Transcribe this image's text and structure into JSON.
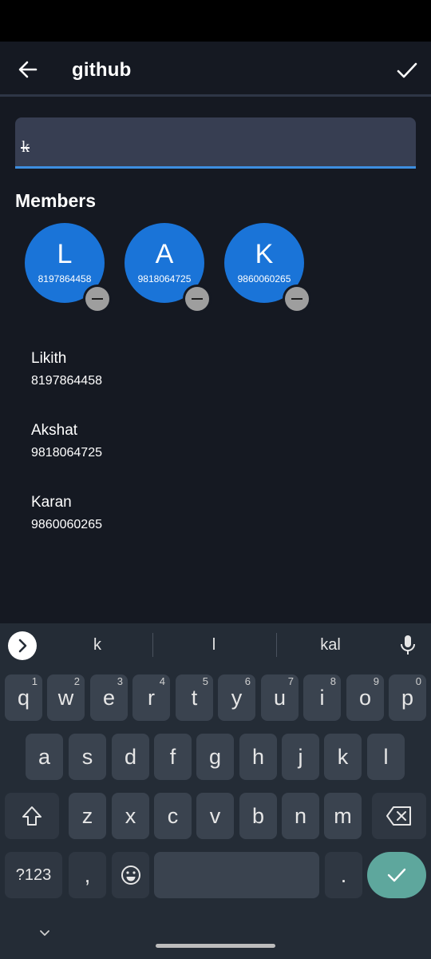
{
  "app_bar": {
    "title": "github"
  },
  "search": {
    "value": "k",
    "placeholder": ""
  },
  "members": {
    "title": "Members",
    "chips": [
      {
        "letter": "L",
        "phone": "8197864458"
      },
      {
        "letter": "A",
        "phone": "9818064725"
      },
      {
        "letter": "K",
        "phone": "9860060265"
      }
    ]
  },
  "contacts": [
    {
      "name": "Likith",
      "phone": "8197864458"
    },
    {
      "name": "Akshat",
      "phone": "9818064725"
    },
    {
      "name": "Karan",
      "phone": "9860060265"
    }
  ],
  "keyboard": {
    "suggestions": [
      "k",
      "l",
      "kal"
    ],
    "row1": [
      {
        "key": "q",
        "hint": "1"
      },
      {
        "key": "w",
        "hint": "2"
      },
      {
        "key": "e",
        "hint": "3"
      },
      {
        "key": "r",
        "hint": "4"
      },
      {
        "key": "t",
        "hint": "5"
      },
      {
        "key": "y",
        "hint": "6"
      },
      {
        "key": "u",
        "hint": "7"
      },
      {
        "key": "i",
        "hint": "8"
      },
      {
        "key": "o",
        "hint": "9"
      },
      {
        "key": "p",
        "hint": "0"
      }
    ],
    "row2": [
      "a",
      "s",
      "d",
      "f",
      "g",
      "h",
      "j",
      "k",
      "l"
    ],
    "row3": [
      "z",
      "x",
      "c",
      "v",
      "b",
      "n",
      "m"
    ],
    "symbols_label": "?123",
    "comma": ",",
    "period": ".",
    "colors": {
      "accent": "#1a74d8",
      "enter": "#5ea79d",
      "background": "#151922",
      "keyboard": "#242c36"
    }
  }
}
